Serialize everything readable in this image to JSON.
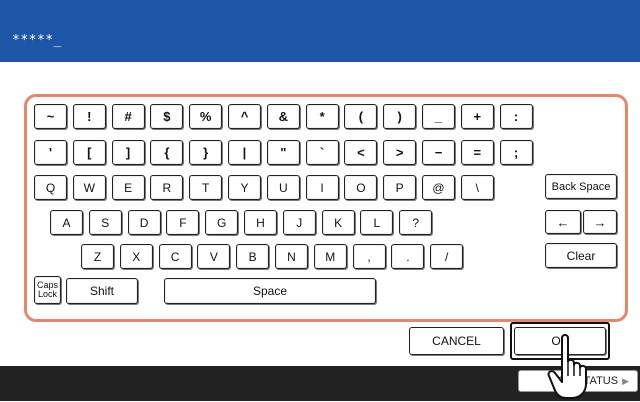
{
  "header": {
    "password_display": "*****_"
  },
  "keyboard": {
    "row1": [
      "~",
      "!",
      "#",
      "$",
      "%",
      "^",
      "&",
      "*",
      "(",
      ")",
      "_",
      "+",
      ":"
    ],
    "row2": [
      "'",
      "[",
      "]",
      "{",
      "}",
      "|",
      "\"",
      "`",
      "<",
      ">",
      "−",
      "=",
      ";"
    ],
    "row3": [
      "Q",
      "W",
      "E",
      "R",
      "T",
      "Y",
      "U",
      "I",
      "O",
      "P",
      "@",
      "\\"
    ],
    "row4": [
      "A",
      "S",
      "D",
      "F",
      "G",
      "H",
      "J",
      "K",
      "L",
      "?"
    ],
    "row5": [
      "Z",
      "X",
      "C",
      "V",
      "B",
      "N",
      "M",
      ",",
      ".",
      "/"
    ],
    "backspace_label": "Back Space",
    "left_arrow": "←",
    "right_arrow": "→",
    "clear_label": "Clear",
    "caps_line1": "Caps",
    "caps_line2": "Lock",
    "shift_label": "Shift",
    "space_label": "Space"
  },
  "actions": {
    "cancel_label": "CANCEL",
    "ok_label": "OK"
  },
  "footer": {
    "job_status_label": "JOB STATUS",
    "job_status_arrow": "▶"
  },
  "icons": [
    "left-arrow-icon",
    "right-arrow-icon",
    "pointing-hand-icon",
    "triangle-right-icon"
  ],
  "colors": {
    "header_bg": "#1d56a7",
    "panel_border": "#e7876a",
    "footer_bg": "#222222"
  }
}
